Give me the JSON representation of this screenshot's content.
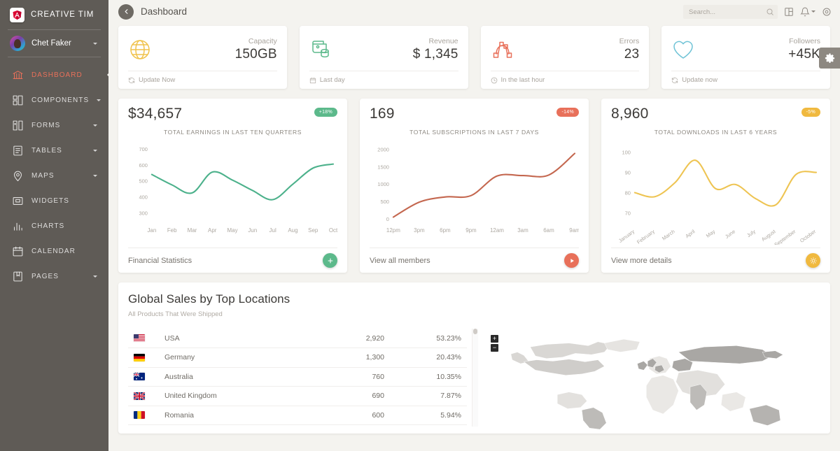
{
  "sidebar": {
    "brand": "CREATIVE TIM",
    "brand_icon": "angular-logo-icon",
    "user": {
      "name": "Chet Faker",
      "avatar": "user-avatar"
    },
    "items": [
      {
        "label": "DASHBOARD",
        "icon": "bank-icon",
        "active": true,
        "caret": false
      },
      {
        "label": "COMPONENTS",
        "icon": "layout-icon",
        "active": false,
        "caret": true
      },
      {
        "label": "FORMS",
        "icon": "forms-icon",
        "active": false,
        "caret": true
      },
      {
        "label": "TABLES",
        "icon": "table-icon",
        "active": false,
        "caret": true
      },
      {
        "label": "MAPS",
        "icon": "pin-icon",
        "active": false,
        "caret": true
      },
      {
        "label": "WIDGETS",
        "icon": "widget-icon",
        "active": false,
        "caret": false
      },
      {
        "label": "CHARTS",
        "icon": "bar-chart-icon",
        "active": false,
        "caret": false
      },
      {
        "label": "CALENDAR",
        "icon": "calendar-icon",
        "active": false,
        "caret": false
      },
      {
        "label": "PAGES",
        "icon": "book-icon",
        "active": false,
        "caret": true
      }
    ]
  },
  "navbar": {
    "title": "Dashboard",
    "back_icon": "chevron-left-icon",
    "search": {
      "placeholder": "Search...",
      "value": "",
      "icon": "search-icon"
    },
    "icons": [
      "dashboard-grid-icon",
      "bell-icon",
      "gear-icon"
    ]
  },
  "floating": {
    "settings_icon": "gear-icon"
  },
  "stats": [
    {
      "label": "Capacity",
      "value": "150GB",
      "foot": "Update Now",
      "foot_icon": "refresh-icon",
      "icon": "globe-icon",
      "color": "#f0c24b"
    },
    {
      "label": "Revenue",
      "value": "$ 1,345",
      "foot": "Last day",
      "foot_icon": "calendar-icon",
      "icon": "wallet-icon",
      "color": "#5cb98b"
    },
    {
      "label": "Errors",
      "value": "23",
      "foot": "In the last hour",
      "foot_icon": "clock-icon",
      "icon": "vector-icon",
      "color": "#e8705a"
    },
    {
      "label": "Followers",
      "value": "+45K",
      "foot": "Update now",
      "foot_icon": "refresh-icon",
      "icon": "heart-icon",
      "color": "#6fc3d6"
    }
  ],
  "chart_data": [
    {
      "type": "line",
      "headline": "$34,657",
      "badge": "+18%",
      "badge_color": "#5cb98b",
      "title": "TOTAL EARNINGS IN LAST TEN QUARTERS",
      "color": "#4cb18b",
      "categories": [
        "Jan",
        "Feb",
        "Mar",
        "Apr",
        "May",
        "Jun",
        "Jul",
        "Aug",
        "Sep",
        "Oct"
      ],
      "values": [
        540,
        475,
        425,
        555,
        505,
        440,
        383,
        480,
        580,
        605
      ],
      "yticks": [
        700,
        600,
        500,
        400,
        300
      ],
      "ylim": [
        250,
        730
      ],
      "xlabel": "",
      "ylabel": "",
      "grid": false,
      "legend": "none",
      "footer_link": "Financial Statistics",
      "footer_button_icon": "plus-icon",
      "footer_button_color": "#5cb98b"
    },
    {
      "type": "line",
      "headline": "169",
      "badge": "-14%",
      "badge_color": "#e8705a",
      "title": "TOTAL SUBSCRIPTIONS IN LAST 7 DAYS",
      "color": "#c4674f",
      "categories": [
        "12pm",
        "3pm",
        "6pm",
        "9pm",
        "12am",
        "3am",
        "6am",
        "9am"
      ],
      "values": [
        50,
        480,
        630,
        670,
        1230,
        1245,
        1260,
        1880
      ],
      "yticks": [
        2000,
        1500,
        1000,
        500,
        0
      ],
      "ylim": [
        -60,
        2150
      ],
      "xlabel": "",
      "ylabel": "",
      "grid": false,
      "legend": "none",
      "footer_link": "View all members",
      "footer_button_icon": "play-icon",
      "footer_button_color": "#e8705a"
    },
    {
      "type": "line",
      "headline": "8,960",
      "badge": "-5%",
      "badge_color": "#f0b93f",
      "title": "TOTAL DOWNLOADS IN LAST 6 YEARS",
      "color": "#eec452",
      "categories": [
        "January",
        "February",
        "March",
        "April",
        "May",
        "June",
        "July",
        "August",
        "September",
        "October"
      ],
      "values": [
        80,
        78,
        85,
        96,
        82,
        84,
        77,
        74,
        89,
        90
      ],
      "yticks": [
        100,
        90,
        80,
        70
      ],
      "ylim": [
        66,
        104
      ],
      "xlabel": "",
      "ylabel": "",
      "grid": false,
      "legend": "none",
      "footer_link": "View more details",
      "footer_button_icon": "sun-icon",
      "footer_button_color": "#f0b93f"
    }
  ],
  "bottom": {
    "title": "Global Sales by Top Locations",
    "subtitle": "All Products That Were Shipped",
    "rows": [
      {
        "flag": "us-flag",
        "country": "USA",
        "sales": "2,920",
        "percent": "53.23%"
      },
      {
        "flag": "de-flag",
        "country": "Germany",
        "sales": "1,300",
        "percent": "20.43%"
      },
      {
        "flag": "au-flag",
        "country": "Australia",
        "sales": "760",
        "percent": "10.35%"
      },
      {
        "flag": "gb-flag",
        "country": "United Kingdom",
        "sales": "690",
        "percent": "7.87%"
      },
      {
        "flag": "ro-flag",
        "country": "Romania",
        "sales": "600",
        "percent": "5.94%"
      }
    ],
    "map": {
      "zoom_in": "+",
      "zoom_out": "−"
    }
  }
}
